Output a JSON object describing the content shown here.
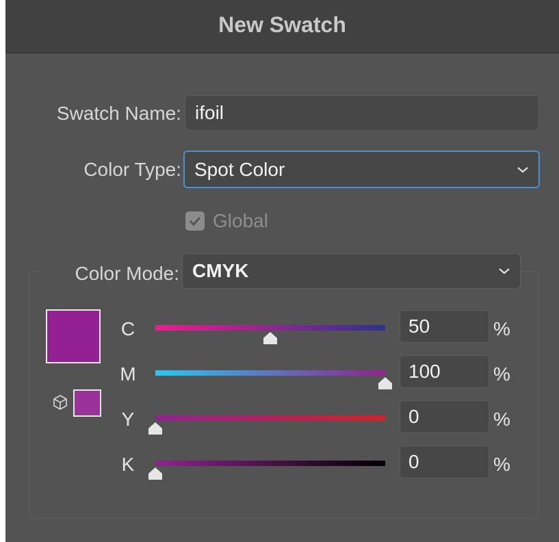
{
  "dialog": {
    "title": "New Swatch"
  },
  "swatch_name": {
    "label": "Swatch Name:",
    "value": "ifoil"
  },
  "color_type": {
    "label": "Color Type:",
    "value": "Spot Color"
  },
  "global": {
    "label": "Global",
    "checked": true
  },
  "color_mode": {
    "label": "Color Mode:",
    "value": "CMYK"
  },
  "swatch_colors": {
    "current": "#942194",
    "web_safe": "#993399"
  },
  "channels": [
    {
      "letter": "C",
      "value": "50",
      "unit": "%",
      "level": 50,
      "gradient": [
        "#ee1d8c",
        "#2e3191"
      ]
    },
    {
      "letter": "M",
      "value": "100",
      "unit": "%",
      "level": 100,
      "gradient": [
        "#28c8f0",
        "#912290"
      ]
    },
    {
      "letter": "Y",
      "value": "0",
      "unit": "%",
      "level": 0,
      "gradient": [
        "#912290",
        "#d0232a"
      ]
    },
    {
      "letter": "K",
      "value": "0",
      "unit": "%",
      "level": 0,
      "gradient": [
        "#912290",
        "#000000"
      ]
    }
  ]
}
